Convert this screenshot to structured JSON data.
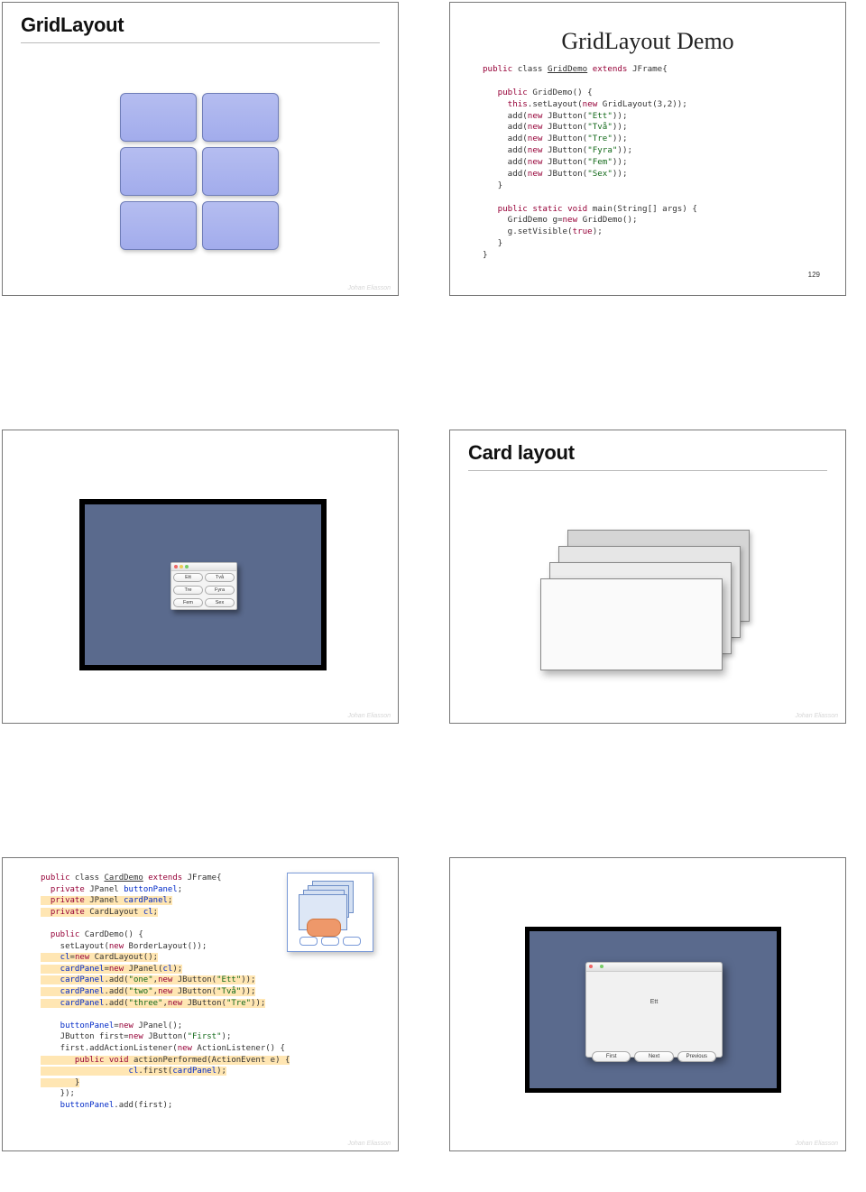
{
  "author": "Johan Eliasson",
  "slide1": {
    "title": "GridLayout"
  },
  "slide2": {
    "title": "GridLayout Demo",
    "pagenum": "129",
    "code": {
      "l1a": "public",
      "l1b": " class ",
      "l1c": "GridDemo",
      "l1d": " extends",
      "l1e": " JFrame{",
      "l2": "",
      "l3a": "   public",
      "l3b": " GridDemo() {",
      "l4a": "     this",
      "l4b": ".setLayout(",
      "l4c": "new",
      "l4d": " GridLayout(3,2));",
      "l5a": "     add(",
      "l5b": "new",
      "l5c": " JButton(",
      "l5d": "\"Ett\"",
      "l5e": "));",
      "l6a": "     add(",
      "l6b": "new",
      "l6c": " JButton(",
      "l6d": "\"Två\"",
      "l6e": "));",
      "l7a": "     add(",
      "l7b": "new",
      "l7c": " JButton(",
      "l7d": "\"Tre\"",
      "l7e": "));",
      "l8a": "     add(",
      "l8b": "new",
      "l8c": " JButton(",
      "l8d": "\"Fyra\"",
      "l8e": "));",
      "l9a": "     add(",
      "l9b": "new",
      "l9c": " JButton(",
      "l9d": "\"Fem\"",
      "l9e": "));",
      "l10a": "     add(",
      "l10b": "new",
      "l10c": " JButton(",
      "l10d": "\"Sex\"",
      "l10e": "));",
      "l11": "   }",
      "l12": "",
      "l13a": "   public",
      "l13b": " static",
      "l13c": " void",
      "l13d": " main(String[] args) {",
      "l14a": "     GridDemo g=",
      "l14b": "new",
      "l14c": " GridDemo();",
      "l15a": "     g.setVisible(",
      "l15b": "true",
      "l15c": ");",
      "l16": "   }",
      "l17": "}"
    }
  },
  "slide3": {
    "buttons": [
      "Ett",
      "Två",
      "Tre",
      "Fyra",
      "Fem",
      "Sex"
    ]
  },
  "slide4": {
    "title": "Card layout"
  },
  "slide5": {
    "code": {
      "l1a": "public",
      "l1b": " class ",
      "l1c": "CardDemo",
      "l1d": " extends",
      "l1e": " JFrame{",
      "l2a": "  private",
      "l2b": " JPanel ",
      "l2c": "buttonPanel",
      "l2d": ";",
      "l3a": "  private",
      "l3b": " JPanel ",
      "l3c": "cardPanel",
      "l3d": ";",
      "l4a": "  private",
      "l4b": " CardLayout ",
      "l4c": "cl",
      "l4d": ";",
      "l5": "",
      "l6a": "  public",
      "l6b": " CardDemo() {",
      "l7a": "    setLayout(",
      "l7b": "new",
      "l7c": " BorderLayout());",
      "l8a": "    cl",
      "l8b": "=",
      "l8c": "new",
      "l8d": " CardLayout();",
      "l9a": "    cardPanel",
      "l9b": "=",
      "l9c": "new",
      "l9d": " JPanel(",
      "l9e": "cl",
      "l9f": ");",
      "l10a": "    cardPanel",
      "l10b": ".add(",
      "l10c": "\"one\"",
      "l10d": ",",
      "l10e": "new",
      "l10f": " JButton(",
      "l10g": "\"Ett\"",
      "l10h": "));",
      "l11a": "    cardPanel",
      "l11b": ".add(",
      "l11c": "\"two\"",
      "l11d": ",",
      "l11e": "new",
      "l11f": " JButton(",
      "l11g": "\"Två\"",
      "l11h": "));",
      "l12a": "    cardPanel",
      "l12b": ".add(",
      "l12c": "\"three\"",
      "l12d": ",",
      "l12e": "new",
      "l12f": " JButton(",
      "l12g": "\"Tre\"",
      "l12h": "));",
      "l13": "",
      "l14a": "    buttonPanel",
      "l14b": "=",
      "l14c": "new",
      "l14d": " JPanel();",
      "l15a": "    JButton first=",
      "l15b": "new",
      "l15c": " JButton(",
      "l15d": "\"First\"",
      "l15e": ");",
      "l16a": "    first.addActionListener(",
      "l16b": "new",
      "l16c": " ActionListener() {",
      "l17a": "       public",
      "l17b": " void",
      "l17c": " actionPerformed(ActionEvent e) {",
      "l18a": "         cl",
      "l18b": ".first(",
      "l18c": "cardPanel",
      "l18d": ");",
      "l19": "       }",
      "l20": "    });",
      "l21a": "    buttonPanel",
      "l21b": ".add(first);"
    }
  },
  "slide6": {
    "center": "Ett",
    "buttons": [
      "First",
      "Next",
      "Previous"
    ]
  }
}
